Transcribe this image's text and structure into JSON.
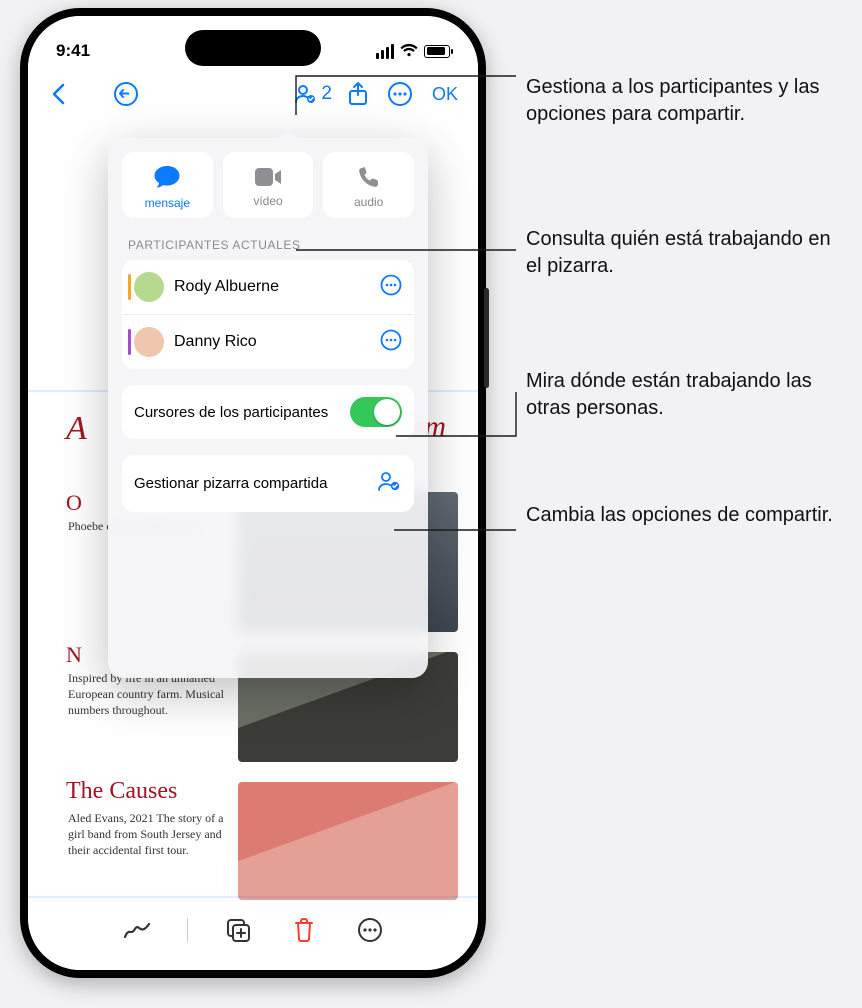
{
  "statusbar": {
    "time": "9:41"
  },
  "toolbar": {
    "collab_count": "2",
    "ok_label": "OK"
  },
  "popover": {
    "comm": {
      "message": "mensaje",
      "video": "vídeo",
      "audio": "audio"
    },
    "section_title": "PARTICIPANTES ACTUALES",
    "participants": [
      {
        "name": "Rody Albuerne",
        "color": "#f5a623",
        "avatar_bg": "#b5d98f"
      },
      {
        "name": "Danny Rico",
        "color": "#a24bd9",
        "avatar_bg": "#efc6ae"
      }
    ],
    "cursors_label": "Cursores de los participantes",
    "manage_label": "Gestionar pizarra compartida"
  },
  "canvas": {
    "title_left": "A",
    "title_right": "eam",
    "section1_head": "O",
    "section1_body": "Phoebe cites\nan older movie.",
    "section2_head": "N",
    "section2_body": "Inspired by life\nin an unnamed\nEuropean country\nfarm. Musical\nnumbers throughout.",
    "section3_head": "The Causes",
    "section3_body": "Aled Evans, 2021\nThe story of a\ngirl band from\nSouth Jersey and\ntheir accidental\nfirst tour."
  },
  "callouts": {
    "c1": "Gestiona a los participantes y las opciones para compartir.",
    "c2": "Consulta quién está trabajando en el pizarra.",
    "c3": "Mira dónde están trabajando las otras personas.",
    "c4": "Cambia las opciones de compartir."
  }
}
